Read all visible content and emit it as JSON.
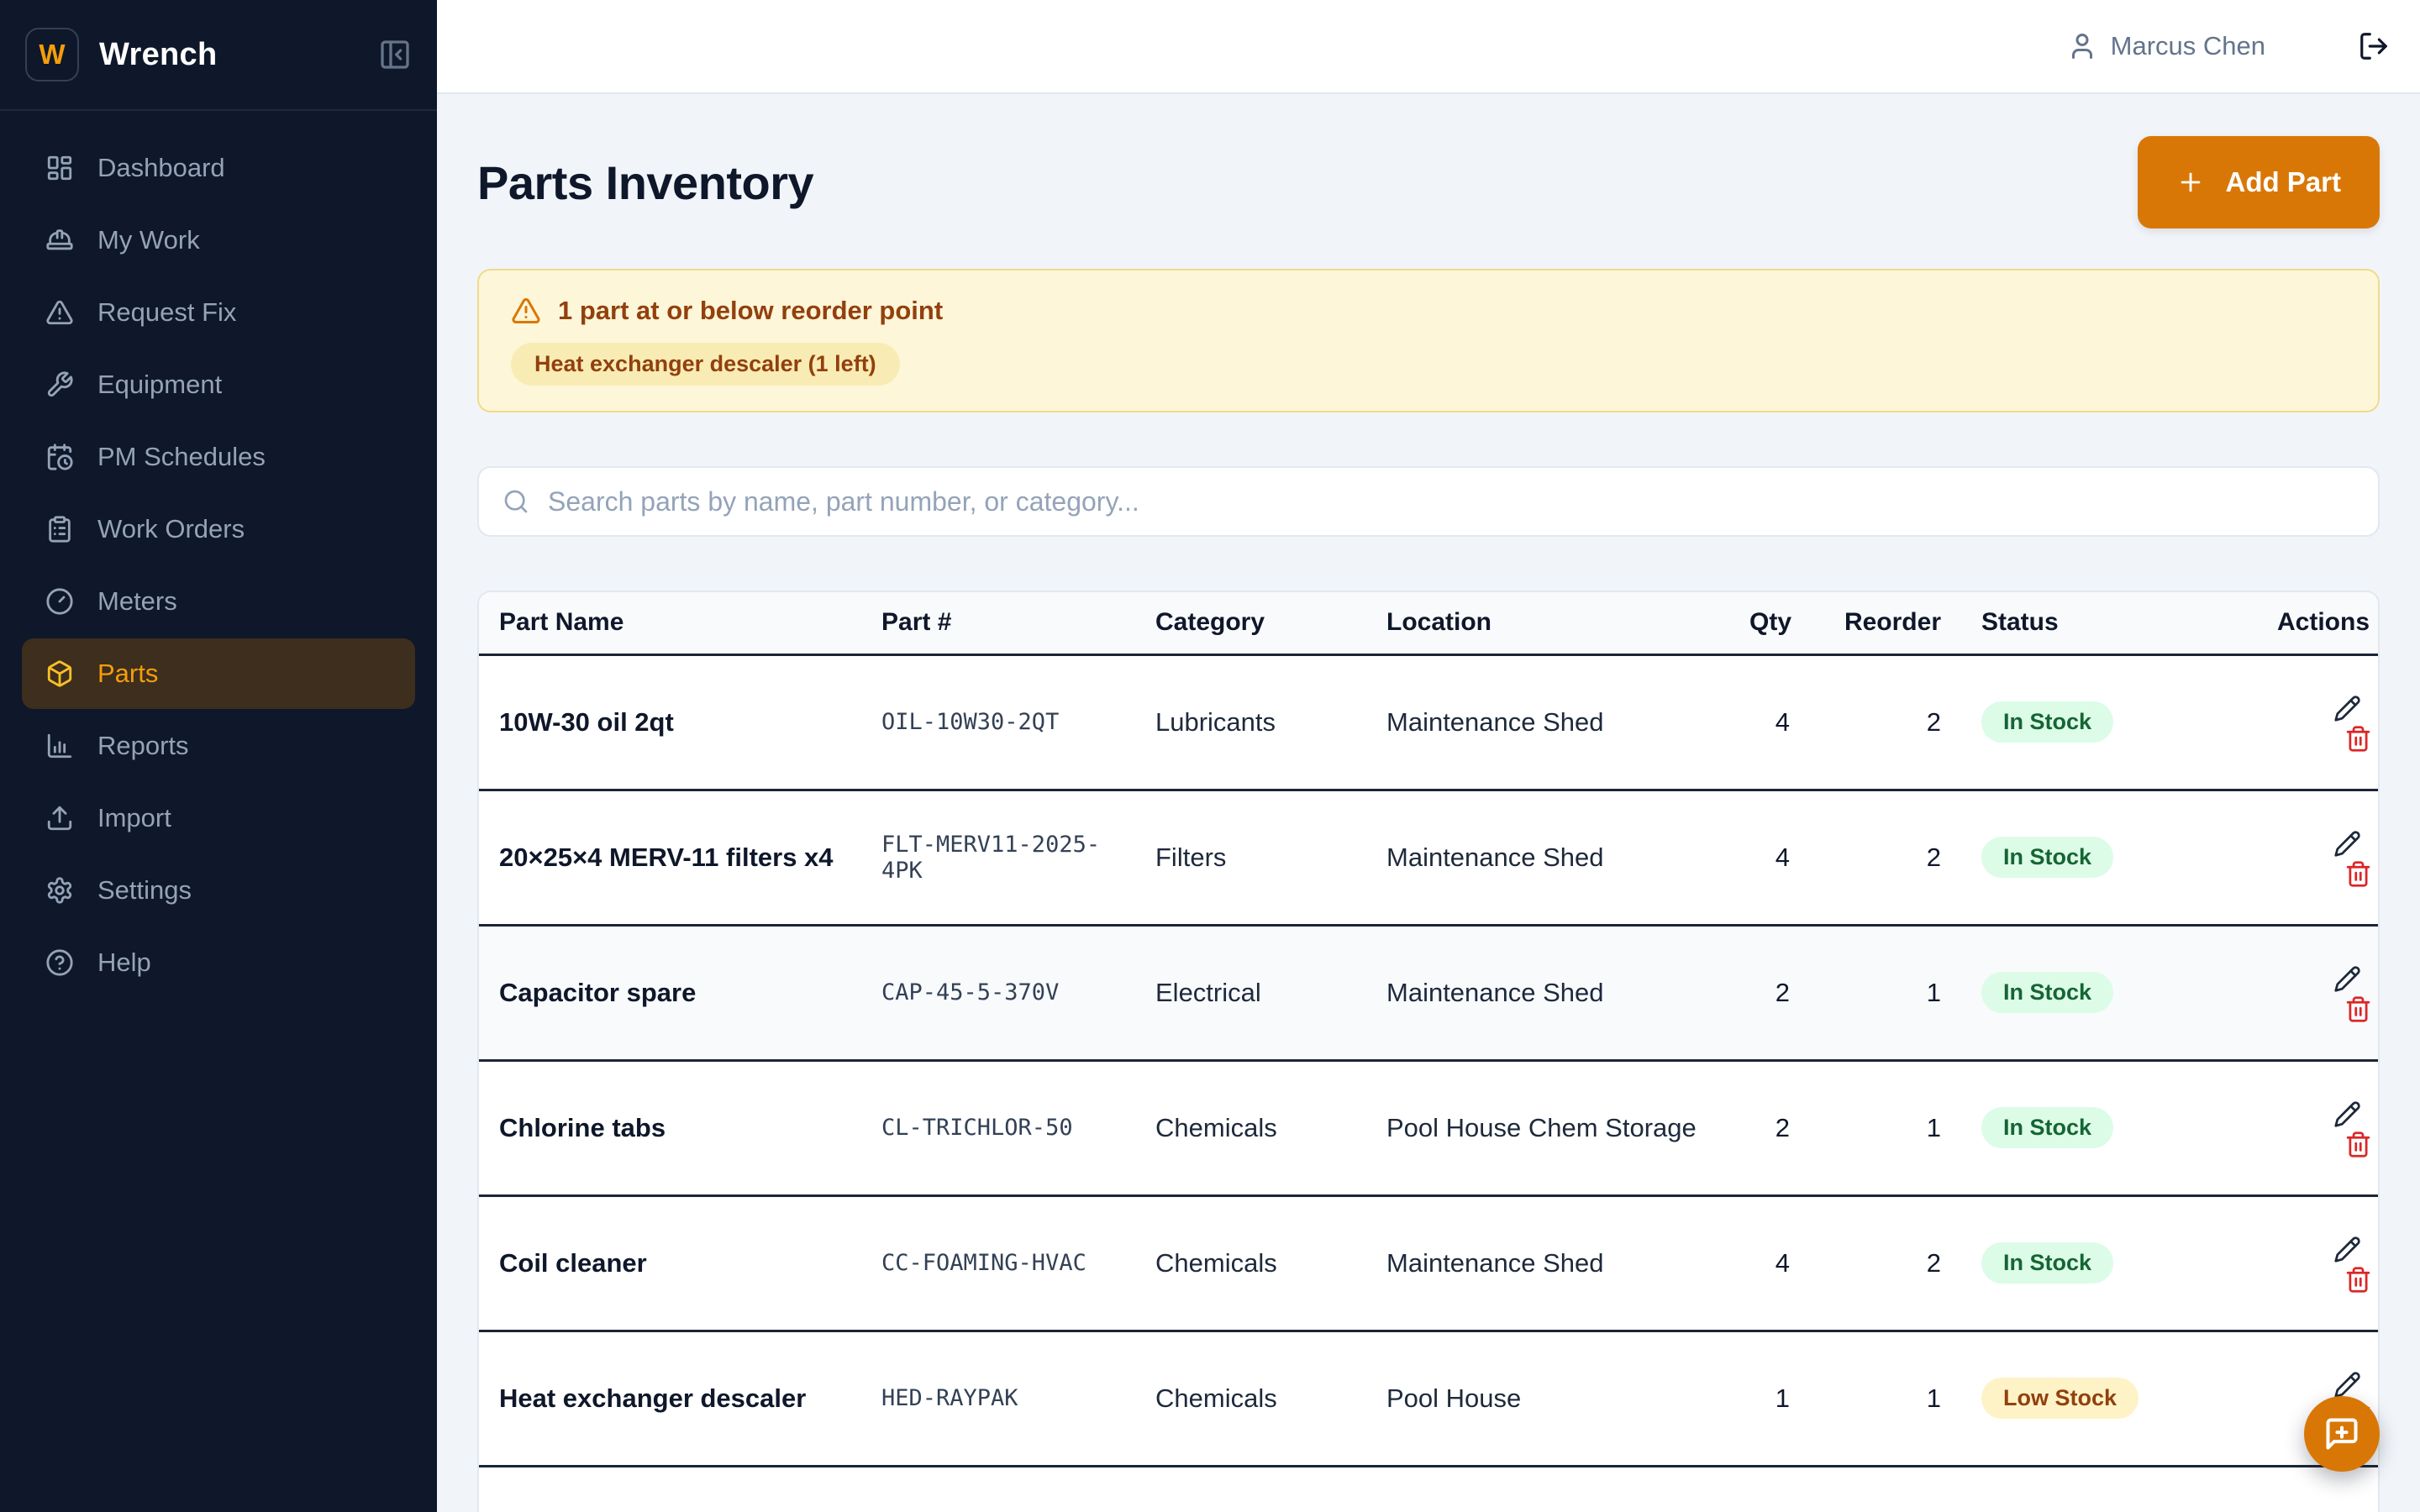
{
  "brand": {
    "name": "Wrench",
    "logo_letter": "W"
  },
  "sidebar": {
    "items": [
      {
        "label": "Dashboard"
      },
      {
        "label": "My Work"
      },
      {
        "label": "Request Fix"
      },
      {
        "label": "Equipment"
      },
      {
        "label": "PM Schedules"
      },
      {
        "label": "Work Orders"
      },
      {
        "label": "Meters"
      },
      {
        "label": "Parts",
        "active": true
      },
      {
        "label": "Reports"
      },
      {
        "label": "Import"
      },
      {
        "label": "Settings"
      },
      {
        "label": "Help"
      }
    ]
  },
  "header": {
    "user_name": "Marcus Chen"
  },
  "page": {
    "title": "Parts Inventory",
    "add_button": "Add Part"
  },
  "alert": {
    "title": "1 part at or below reorder point",
    "chips": [
      "Heat exchanger descaler (1 left)"
    ]
  },
  "search": {
    "placeholder": "Search parts by name, part number, or category..."
  },
  "table": {
    "columns": [
      "Part Name",
      "Part #",
      "Category",
      "Location",
      "Qty",
      "Reorder",
      "Status",
      "Actions"
    ],
    "rows": [
      {
        "name": "10W-30 oil 2qt",
        "part_number": "OIL-10W30-2QT",
        "category": "Lubricants",
        "location": "Maintenance Shed",
        "qty": 4,
        "reorder": 2,
        "status": "In Stock"
      },
      {
        "name": "20×25×4 MERV-11 filters x4",
        "part_number": "FLT-MERV11-2025-4PK",
        "category": "Filters",
        "location": "Maintenance Shed",
        "qty": 4,
        "reorder": 2,
        "status": "In Stock"
      },
      {
        "name": "Capacitor spare",
        "part_number": "CAP-45-5-370V",
        "category": "Electrical",
        "location": "Maintenance Shed",
        "qty": 2,
        "reorder": 1,
        "status": "In Stock"
      },
      {
        "name": "Chlorine tabs",
        "part_number": "CL-TRICHLOR-50",
        "category": "Chemicals",
        "location": "Pool House Chem Storage",
        "qty": 2,
        "reorder": 1,
        "status": "In Stock"
      },
      {
        "name": "Coil cleaner",
        "part_number": "CC-FOAMING-HVAC",
        "category": "Chemicals",
        "location": "Maintenance Shed",
        "qty": 4,
        "reorder": 2,
        "status": "In Stock"
      },
      {
        "name": "Heat exchanger descaler",
        "part_number": "HED-RAYPAK",
        "category": "Chemicals",
        "location": "Pool House",
        "qty": 1,
        "reorder": 1,
        "status": "Low Stock"
      }
    ]
  },
  "colors": {
    "accent": "#d97706",
    "sidebar_bg": "#0f172a",
    "active_nav_text": "#f59e0b",
    "in_stock_bg": "#dcfce7",
    "in_stock_text": "#166534",
    "low_stock_bg": "#fef3c7",
    "low_stock_text": "#92400e",
    "danger": "#dc2626",
    "banner_bg": "#fdf6d8"
  }
}
